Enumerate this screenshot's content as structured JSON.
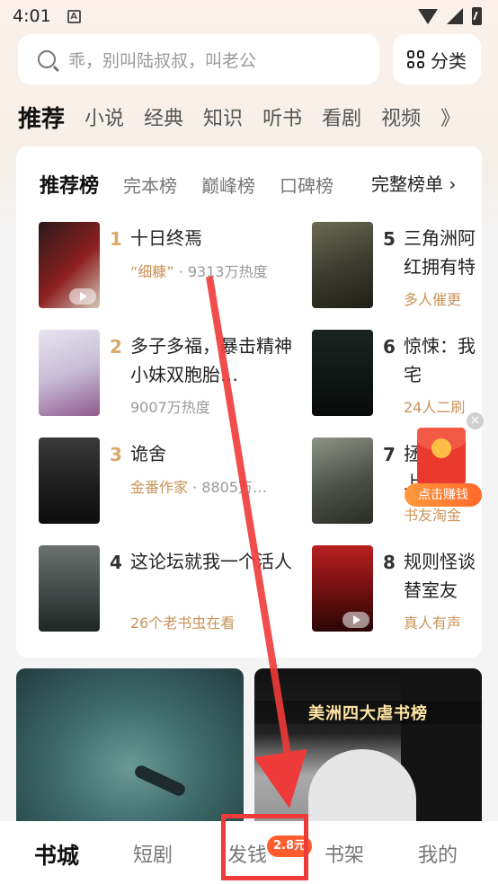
{
  "status": {
    "time": "4:01",
    "notification_icon": "A"
  },
  "search": {
    "placeholder": "乖，别叫陆叔叔，叫老公"
  },
  "category_button": {
    "label": "分类"
  },
  "tabs": [
    "推荐",
    "小说",
    "经典",
    "知识",
    "听书",
    "看剧",
    "视频",
    "》"
  ],
  "rank": {
    "tabs": [
      "推荐榜",
      "完本榜",
      "巅峰榜",
      "口碑榜"
    ],
    "full_label": "完整榜单 ›",
    "books": [
      {
        "num": "1",
        "title": "十日终焉",
        "meta_highlight": "“细糠”",
        "meta_rest": " · 9313万热度"
      },
      {
        "num": "2",
        "title": "多子多福，暴击精神小妹双胞胎…",
        "meta_highlight": "",
        "meta_rest": "9007万热度"
      },
      {
        "num": "3",
        "title": "诡舍",
        "meta_highlight": "金番作家",
        "meta_rest": " · 8805万…"
      },
      {
        "num": "4",
        "title": "这论坛就我一个活人",
        "meta_highlight": "26个老书虫在看",
        "meta_rest": ""
      },
      {
        "num": "5",
        "title": "三角洲阿红拥有特",
        "meta_highlight": "多人催更",
        "meta_rest": ""
      },
      {
        "num": "6",
        "title": "惊悚：我宅",
        "meta_highlight": "24人二刷",
        "meta_rest": ""
      },
      {
        "num": "7",
        "title": "拯上",
        "meta_highlight": "书友淘金",
        "meta_rest": ""
      },
      {
        "num": "8",
        "title": "规则怪谈替室友",
        "meta_highlight": "真人有声",
        "meta_rest": ""
      }
    ]
  },
  "float": {
    "close": "×",
    "earn_label": "点击赚钱"
  },
  "banner_right_title": "美洲四大虐书榜",
  "bottom_nav": [
    "书城",
    "短剧",
    "发钱",
    "书架",
    "我的"
  ],
  "badge": "2.8元",
  "colors": {
    "accent": "#c9945a",
    "annotation": "#ef3a3a",
    "badge": "#ff5d2e"
  }
}
